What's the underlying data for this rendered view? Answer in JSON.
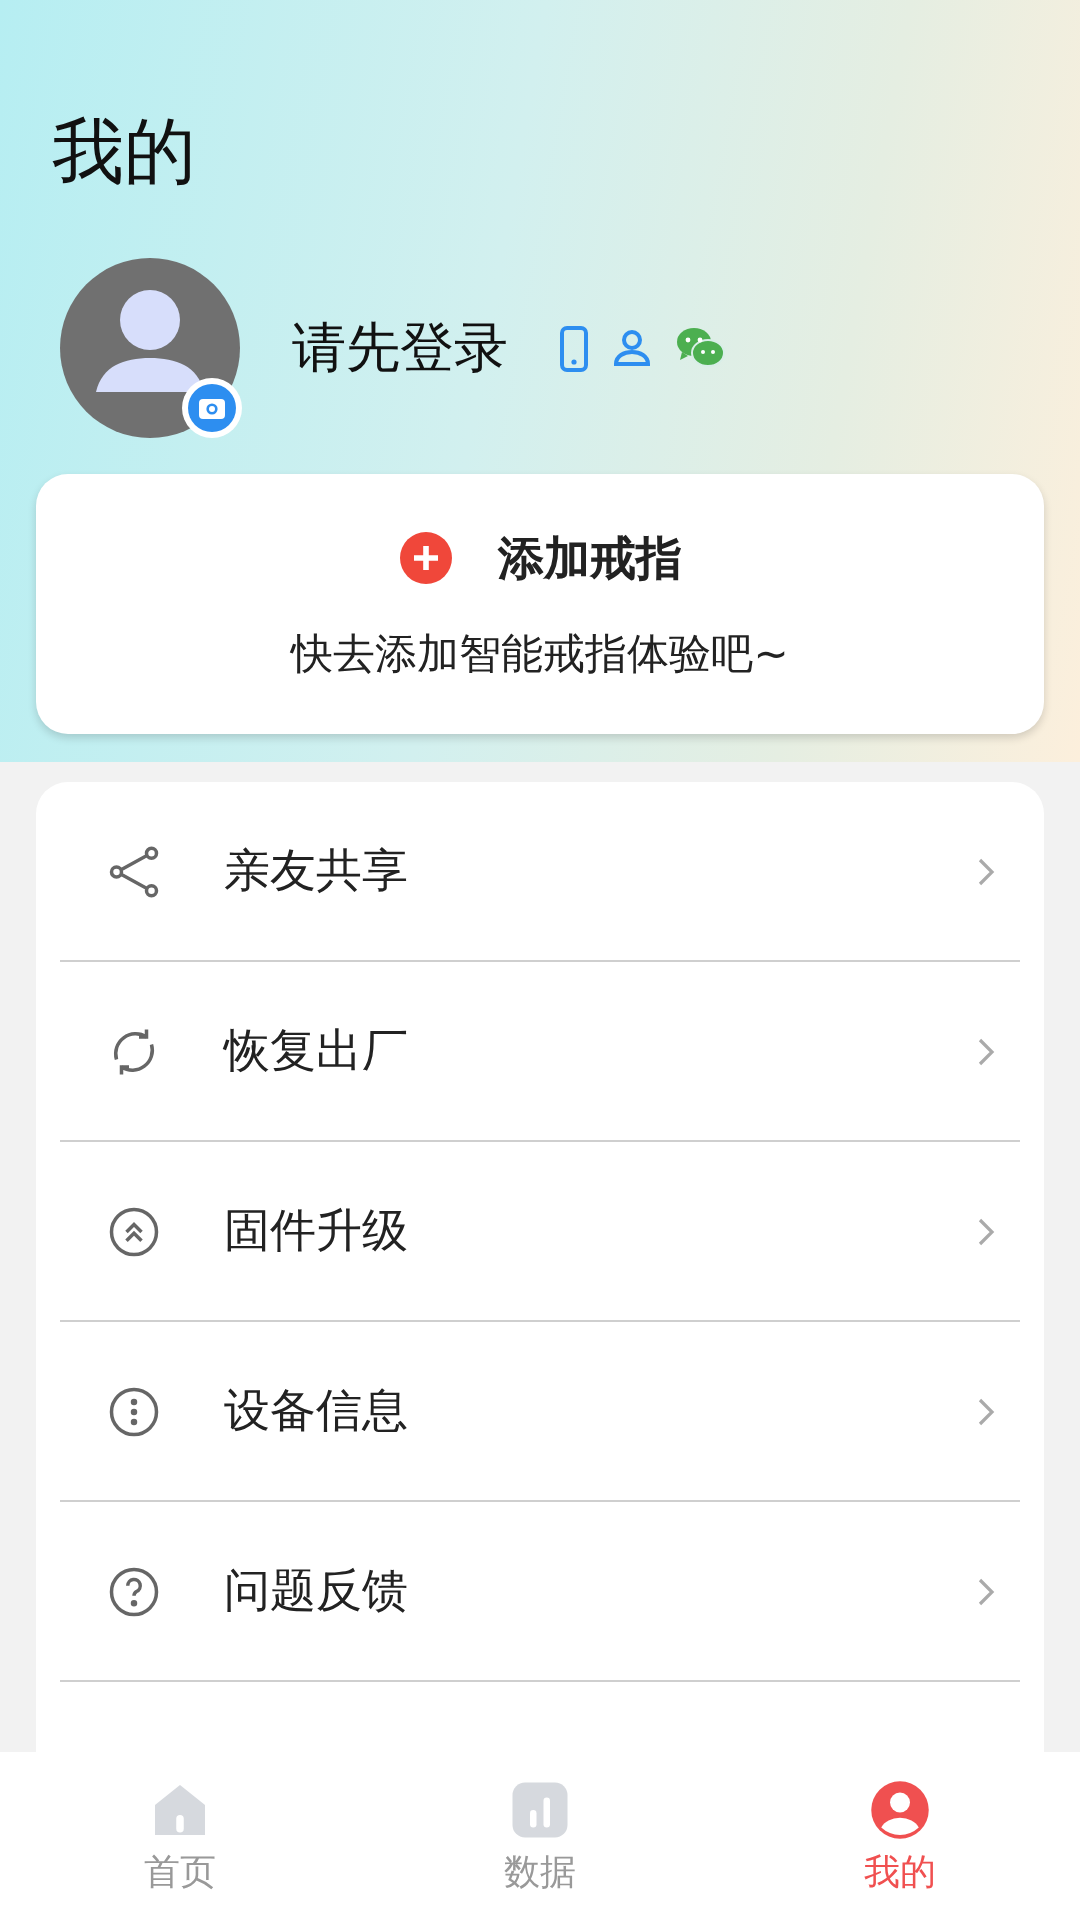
{
  "page_title": "我的",
  "profile": {
    "login_prompt": "请先登录"
  },
  "add_ring": {
    "title": "添加戒指",
    "subtitle": "快去添加智能戒指体验吧~"
  },
  "menu": [
    {
      "kind": "share",
      "label": "亲友共享"
    },
    {
      "kind": "reset",
      "label": "恢复出厂"
    },
    {
      "kind": "upgrade",
      "label": "固件升级"
    },
    {
      "kind": "info",
      "label": "设备信息"
    },
    {
      "kind": "help",
      "label": "问题反馈"
    }
  ],
  "tab_bar": [
    {
      "kind": "home",
      "label": "首页",
      "selected": false
    },
    {
      "kind": "data",
      "label": "数据",
      "selected": false
    },
    {
      "kind": "me",
      "label": "我的",
      "selected": true
    }
  ]
}
